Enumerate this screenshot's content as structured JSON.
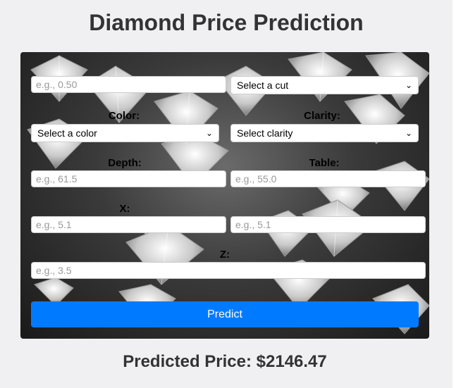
{
  "page": {
    "title": "Diamond Price Prediction"
  },
  "form": {
    "carat": {
      "placeholder": "e.g., 0.50"
    },
    "cut": {
      "selected": "Select a cut"
    },
    "color": {
      "label": "Color:",
      "selected": "Select a color"
    },
    "clarity": {
      "label": "Clarity:",
      "selected": "Select clarity"
    },
    "depth": {
      "label": "Depth:",
      "placeholder": "e.g., 61.5"
    },
    "table": {
      "label": "Table:",
      "placeholder": "e.g., 55.0"
    },
    "x": {
      "label": "X:",
      "placeholder": "e.g., 5.1"
    },
    "y": {
      "placeholder": "e.g., 5.1"
    },
    "z": {
      "label": "Z:",
      "placeholder": "e.g., 3.5"
    },
    "submit_label": "Predict"
  },
  "result": {
    "text": "Predicted Price: $2146.47"
  },
  "colors": {
    "accent": "#007bff",
    "title": "#333333"
  },
  "icons": {
    "select_arrow": "chevron-down-icon"
  }
}
